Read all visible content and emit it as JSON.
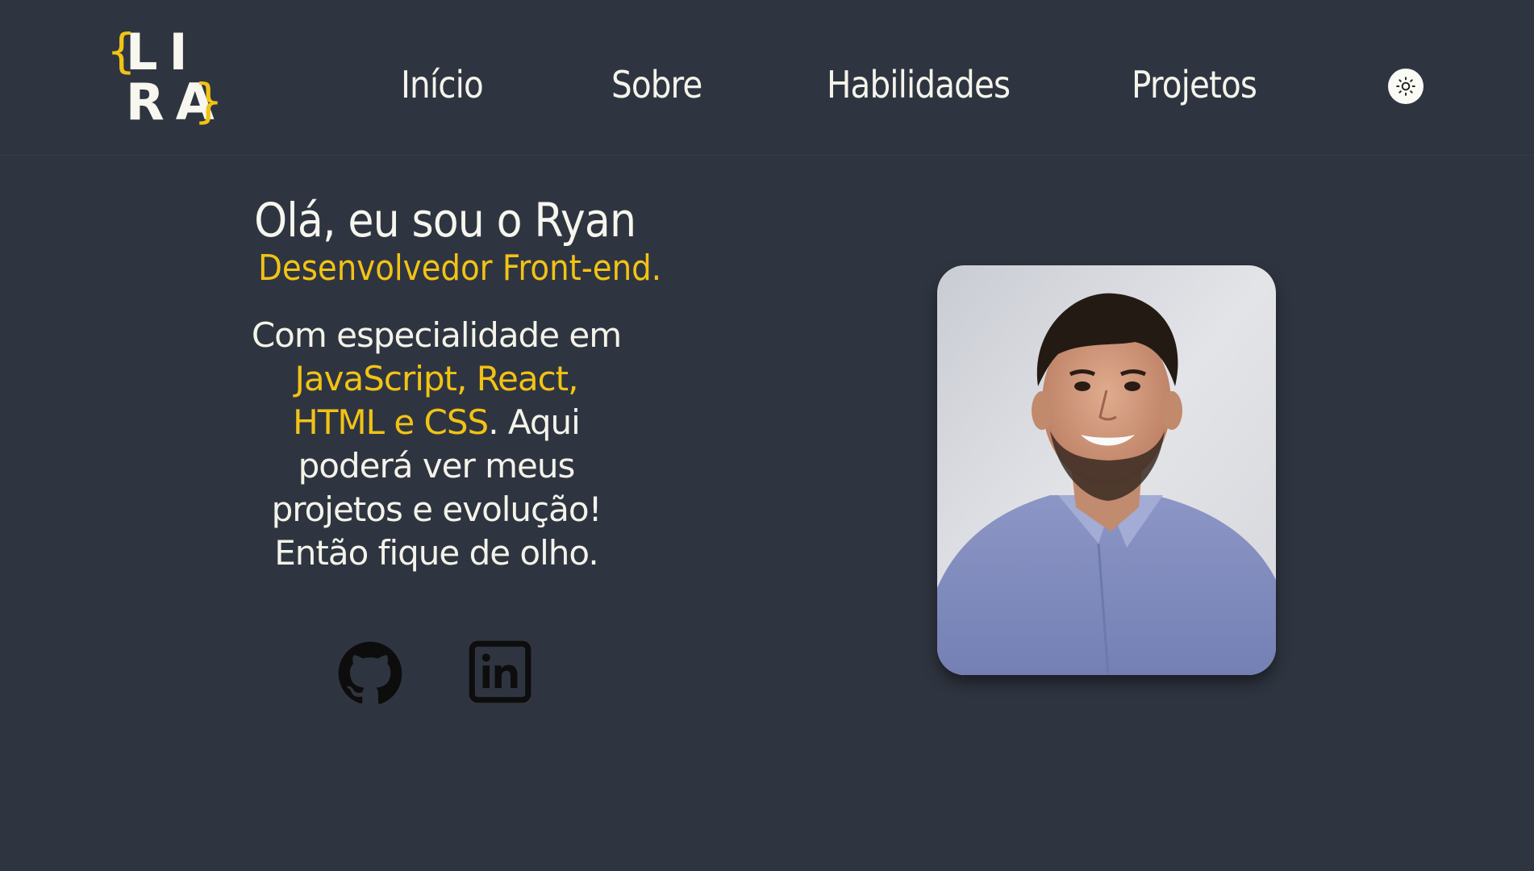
{
  "logo": {
    "brace_open": "{",
    "brace_close": "}",
    "line1": "LI",
    "line2": "RA"
  },
  "nav": {
    "items": [
      {
        "label": "Início"
      },
      {
        "label": "Sobre"
      },
      {
        "label": "Habilidades"
      },
      {
        "label": "Projetos"
      }
    ],
    "theme_icon": "sun-icon"
  },
  "hero": {
    "title": "Olá, eu sou o Ryan",
    "role": "Desenvolvedor Front-end.",
    "desc_part1": "Com especialidade em ",
    "desc_highlight": "JavaScript, React, HTML e CSS",
    "desc_part2": ". Aqui poderá ver meus projetos e evolução! Então fique de olho."
  },
  "socials": [
    {
      "icon": "github-icon"
    },
    {
      "icon": "linkedin-icon"
    }
  ],
  "colors": {
    "background": "#2f3540",
    "accent": "#f2c315",
    "text": "#f5f5ee"
  }
}
